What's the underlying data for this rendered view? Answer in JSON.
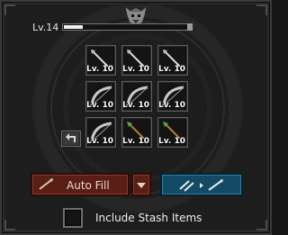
{
  "header": {
    "level_label": "Lv.14",
    "xp_progress": 0.15,
    "emblem_icon": "gargoyle-icon"
  },
  "slots": [
    {
      "item_icon": "arrow-icon",
      "level": "Lv. 10"
    },
    {
      "item_icon": "arrow-icon",
      "level": "Lv. 10"
    },
    {
      "item_icon": "arrow-icon",
      "level": "Lv. 10"
    },
    {
      "item_icon": "bow-icon",
      "level": "Lv. 10"
    },
    {
      "item_icon": "bow-icon",
      "level": "Lv. 10"
    },
    {
      "item_icon": "bow-icon",
      "level": "Lv. 10"
    },
    {
      "item_icon": "bow-icon",
      "level": "Lv. 10"
    },
    {
      "item_icon": "green-arrow-icon",
      "level": "Lv. 10"
    },
    {
      "item_icon": "green-arrow-icon",
      "level": "Lv. 10"
    }
  ],
  "buttons": {
    "auto_fill_label": "Auto Fill",
    "back_icon": "return-arrow-icon",
    "dropdown_icon": "chevron-down-icon",
    "transfer_icon": "transfer-items-icon"
  },
  "stash": {
    "checkbox_label": "Include Stash Items",
    "checked": false
  },
  "colors": {
    "auto_fill_bg": "#5a1e16",
    "transfer_bg": "#134a66",
    "panel_bg": "#1d1d1d"
  }
}
